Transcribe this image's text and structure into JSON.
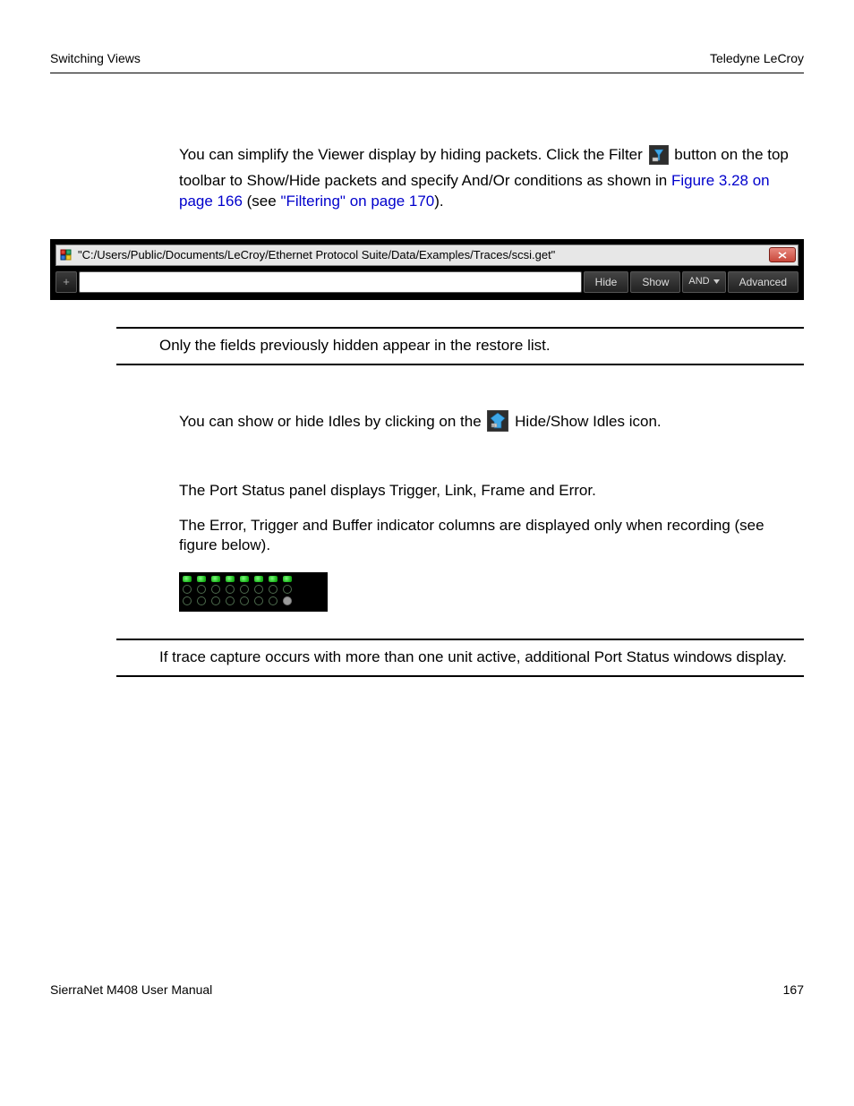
{
  "header": {
    "left": "Switching Views",
    "right": "Teledyne LeCroy"
  },
  "para1": {
    "t1": "You can simplify the Viewer display by hiding packets. Click the Filter ",
    "t2": " button on the top toolbar to Show/Hide packets and specify And/Or conditions as shown in ",
    "link1": "Figure 3.28 on page 166",
    "t3": " (see ",
    "link2": "\"Filtering\" on page 170",
    "t4": ")."
  },
  "screenshot": {
    "path": "\"C:/Users/Public/Documents/LeCroy/Ethernet Protocol Suite/Data/Examples/Traces/scsi.get\"",
    "plus": "+",
    "hide": "Hide",
    "show": "Show",
    "and": "AND",
    "advanced": "Advanced"
  },
  "note1": "Only the fields previously hidden appear in the restore list.",
  "para2": {
    "t1": "You can show or hide Idles by clicking on the ",
    "t2": " Hide/Show Idles icon."
  },
  "para3": "The Port Status panel displays Trigger, Link, Frame and Error.",
  "para4": "The Error, Trigger and Buffer indicator columns are displayed only when recording (see figure below).",
  "note2": "If trace capture occurs with more than one unit active, additional Port Status windows display.",
  "footer": {
    "left": "SierraNet M408 User Manual",
    "right": "167"
  }
}
